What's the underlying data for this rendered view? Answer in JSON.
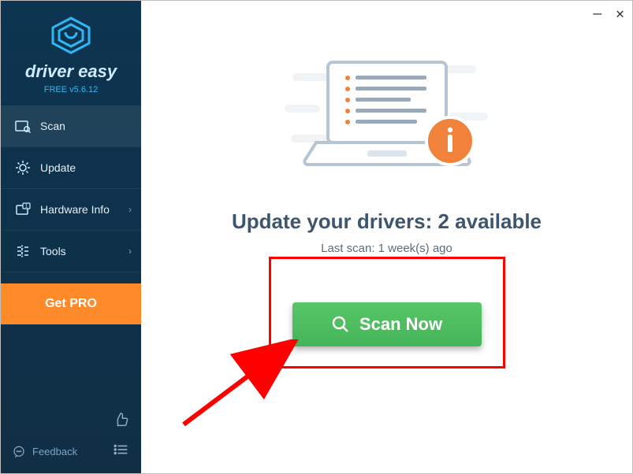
{
  "brand": {
    "name": "driver easy",
    "version": "FREE v5.6.12"
  },
  "nav": {
    "items": [
      {
        "label": "Scan",
        "has_chevron": false
      },
      {
        "label": "Update",
        "has_chevron": false
      },
      {
        "label": "Hardware Info",
        "has_chevron": true
      },
      {
        "label": "Tools",
        "has_chevron": true
      }
    ],
    "get_pro": "Get PRO",
    "feedback": "Feedback"
  },
  "main": {
    "headline": "Update your drivers: 2 available",
    "subline": "Last scan: 1 week(s) ago",
    "scan_button": "Scan Now"
  }
}
